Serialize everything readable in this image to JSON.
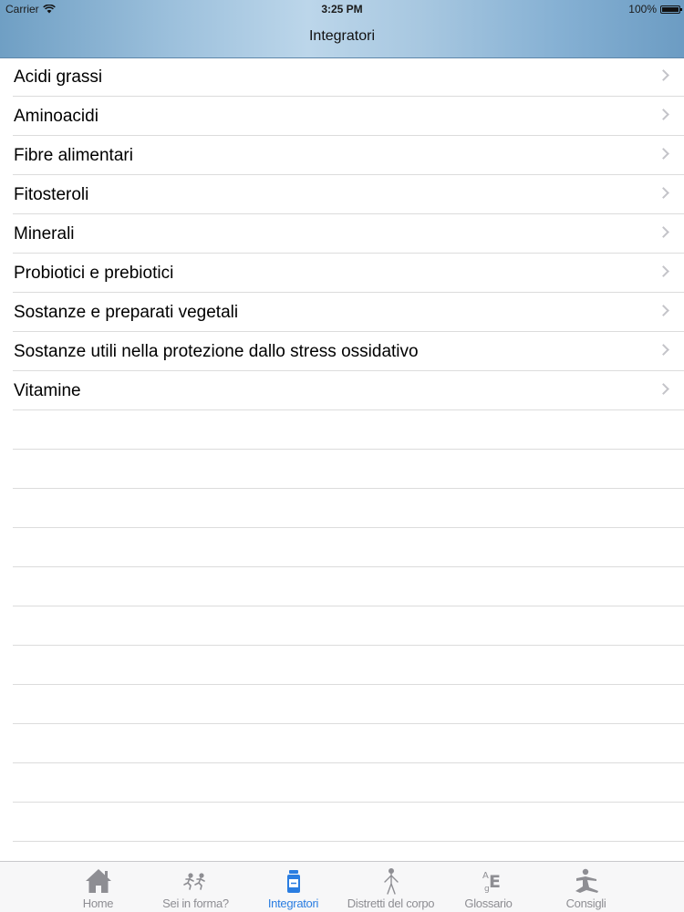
{
  "status_bar": {
    "carrier": "Carrier",
    "time": "3:25 PM",
    "battery": "100%"
  },
  "nav": {
    "title": "Integratori"
  },
  "list": {
    "items": [
      {
        "label": "Acidi grassi"
      },
      {
        "label": "Aminoacidi"
      },
      {
        "label": "Fibre alimentari"
      },
      {
        "label": "Fitosteroli"
      },
      {
        "label": "Minerali"
      },
      {
        "label": "Probiotici e prebiotici"
      },
      {
        "label": "Sostanze e preparati vegetali"
      },
      {
        "label": "Sostanze utili nella protezione dallo stress ossidativo"
      },
      {
        "label": "Vitamine"
      }
    ],
    "icon": "chevron-right-icon"
  },
  "tabbar": {
    "active_color": "#2a7de1",
    "inactive_color": "#8e8e93",
    "tabs": [
      {
        "label": "Home",
        "icon": "home-icon",
        "active": false
      },
      {
        "label": "Sei in  forma?",
        "icon": "runners-icon",
        "active": false
      },
      {
        "label": "Integratori",
        "icon": "supplement-bottle-icon",
        "active": true
      },
      {
        "label": "Distretti del corpo",
        "icon": "human-body-icon",
        "active": false
      },
      {
        "label": "Glossario",
        "icon": "glossary-icon",
        "active": false
      },
      {
        "label": "Consigli",
        "icon": "yoga-pose-icon",
        "active": false
      }
    ]
  }
}
